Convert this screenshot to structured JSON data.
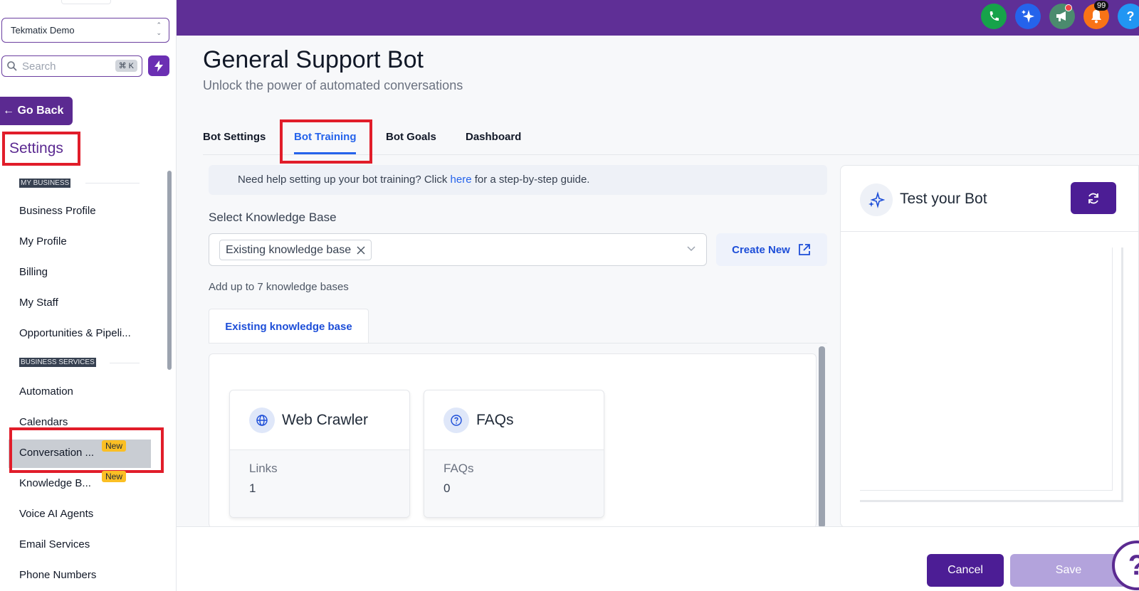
{
  "sidebar": {
    "location": "Tekmatix Demo",
    "search_placeholder": "Search",
    "search_shortcut": "⌘ K",
    "go_back": "← Go Back",
    "settings_title": "Settings",
    "sections": [
      {
        "label": "MY BUSINESS"
      },
      {
        "label": "BUSINESS SERVICES"
      }
    ],
    "items": [
      {
        "label": "Business Profile"
      },
      {
        "label": "My Profile"
      },
      {
        "label": "Billing"
      },
      {
        "label": "My Staff"
      },
      {
        "label": "Opportunities & Pipeli..."
      },
      {
        "label": "Automation"
      },
      {
        "label": "Calendars"
      },
      {
        "label": "Conversation ...",
        "badge": "New"
      },
      {
        "label": "Knowledge B...",
        "badge": "New"
      },
      {
        "label": "Voice AI Agents"
      },
      {
        "label": "Email Services"
      },
      {
        "label": "Phone Numbers"
      }
    ]
  },
  "topbar": {
    "notification_count": "99",
    "help_label": "?",
    "colors": {
      "phone": "#16a34a",
      "ai": "#2563eb",
      "announce": "#4b8b6e",
      "bell": "#f97316",
      "help": "#2196f3"
    }
  },
  "page": {
    "title": "General Support Bot",
    "subtitle": "Unlock the power of automated conversations"
  },
  "tabs": [
    {
      "label": "Bot Settings"
    },
    {
      "label": "Bot Training"
    },
    {
      "label": "Bot Goals"
    },
    {
      "label": "Dashboard"
    }
  ],
  "training": {
    "help_prefix": "Need help setting up your bot training? Click ",
    "help_link": "here",
    "help_suffix": " for a step-by-step guide.",
    "kb_label": "Select Knowledge Base",
    "kb_selected": "Existing knowledge base",
    "create_new": "Create New",
    "kb_hint": "Add up to 7 knowledge bases",
    "kb_tab": "Existing knowledge base",
    "sources": [
      {
        "title": "Web Crawler",
        "metric_label": "Links",
        "metric_value": "1",
        "icon": "globe-icon"
      },
      {
        "title": "FAQs",
        "metric_label": "FAQs",
        "metric_value": "0",
        "icon": "question-icon"
      }
    ]
  },
  "test_bot": {
    "title": "Test your Bot"
  },
  "footer": {
    "cancel": "Cancel",
    "save": "Save"
  }
}
